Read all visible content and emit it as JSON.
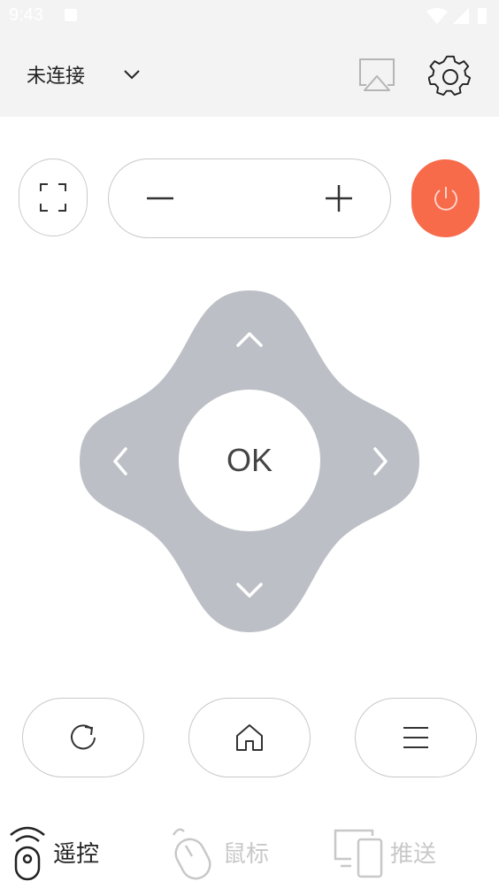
{
  "status_bar": {
    "time": "9:43"
  },
  "header": {
    "connection_label": "未连接",
    "icons": [
      "chevron-down-icon",
      "screen-cast-icon",
      "gear-icon"
    ]
  },
  "top_controls": {
    "fullscreen_icon": "fullscreen-icon",
    "volume_down_icon": "minus-icon",
    "volume_up_icon": "plus-icon",
    "power_icon": "power-icon"
  },
  "dpad": {
    "ok_label": "OK",
    "icons": [
      "chevron-up-icon",
      "chevron-down-icon",
      "chevron-left-icon",
      "chevron-right-icon"
    ]
  },
  "bottom_controls": {
    "icons": [
      "refresh-icon",
      "home-icon",
      "menu-icon"
    ]
  },
  "bottom_nav": {
    "items": [
      {
        "label": "遥控",
        "icon": "remote-icon",
        "active": true
      },
      {
        "label": "鼠标",
        "icon": "mouse-icon",
        "active": false
      },
      {
        "label": "推送",
        "icon": "devices-icon",
        "active": false
      }
    ]
  },
  "colors": {
    "header_bg": "#f3f3f3",
    "power_accent": "#f76a4a",
    "dpad_fill": "#bcc0c6",
    "border": "#c9c9c9",
    "text_active": "#222222",
    "text_inactive": "#c8c8c8"
  }
}
